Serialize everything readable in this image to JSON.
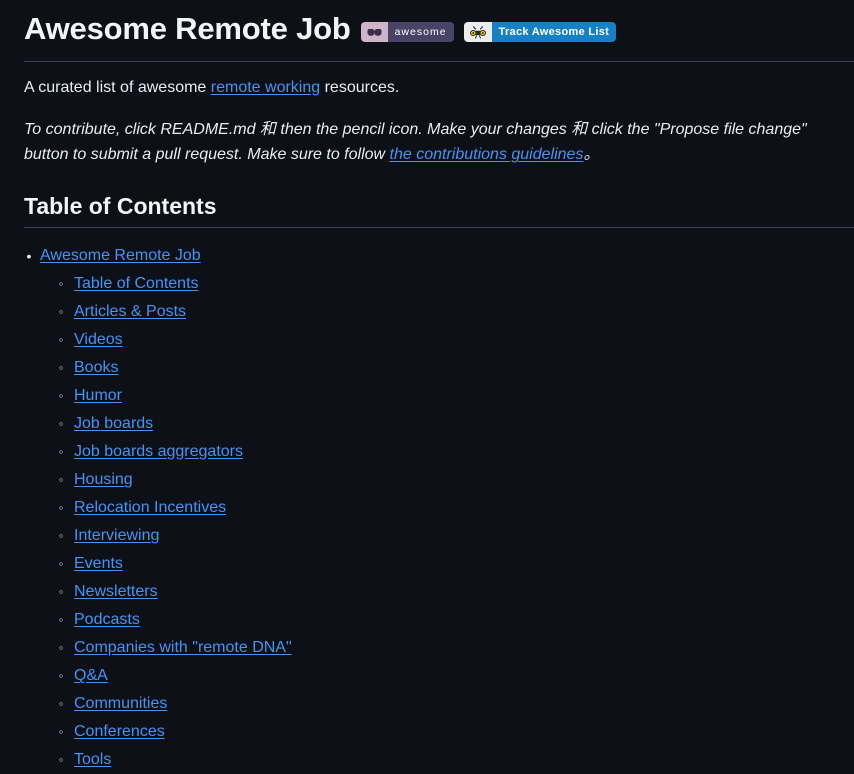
{
  "header": {
    "title": "Awesome Remote Job",
    "badges": [
      {
        "name": "awesome-badge",
        "icon": "sunglasses-icon",
        "label": "awesome",
        "left_color": "#cdb4c8",
        "right_color": "#494368"
      },
      {
        "name": "track-awesome-list-badge",
        "icon": "bee-icon",
        "label": "Track Awesome List",
        "left_color": "#ececec",
        "right_color": "#1580c4"
      }
    ]
  },
  "intro": {
    "before_link": "A curated list of awesome ",
    "link_text": "remote working",
    "after_link": " resources."
  },
  "contribute": {
    "part1": "To contribute, click README.md 和 then the pencil icon. Make your changes 和 click the \"Propose file change\" button to submit a pull request. Make sure to follow ",
    "link_text": "the contributions guidelines",
    "part2": "。"
  },
  "toc": {
    "heading": "Table of Contents",
    "root_item": "Awesome Remote Job",
    "items": [
      "Table of Contents",
      "Articles & Posts",
      "Videos",
      "Books",
      "Humor",
      "Job boards",
      "Job boards aggregators",
      "Housing",
      "Relocation Incentives",
      "Interviewing",
      "Events",
      "Newsletters",
      "Podcasts",
      "Companies with \"remote DNA\"",
      "Q&A",
      "Communities",
      "Conferences",
      "Tools"
    ],
    "bullet_root": "•",
    "bullet_sub": "◦"
  },
  "colors": {
    "background": "#0d1117",
    "text": "#e6edf3",
    "link": "#4493f8",
    "rule": "#3d444d",
    "heading": "#f0f6fc"
  }
}
